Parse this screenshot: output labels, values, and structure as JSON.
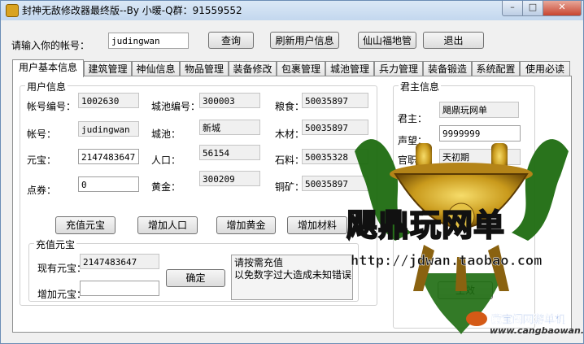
{
  "window": {
    "title": "封神无敌修改器最终版--By 小暖-Q群：91559552",
    "min_glyph": "–",
    "max_glyph": "□",
    "close_glyph": "✕"
  },
  "account": {
    "label": "请输入你的帐号：",
    "value": "judingwan"
  },
  "top_buttons": {
    "query": "查询",
    "refresh": "刷新用户信息",
    "xianshan": "仙山福地管",
    "exit": "退出"
  },
  "tabs": [
    "用户基本信息",
    "建筑管理",
    "神仙信息",
    "物品管理",
    "装备修改",
    "包裹管理",
    "城池管理",
    "兵力管理",
    "装备锻造",
    "系统配置",
    "使用必读"
  ],
  "user_info": {
    "group_title": "用户信息",
    "account_no_label": "帐号编号：",
    "account_no": "1002630",
    "account_label": "帐号：",
    "account": "judingwan",
    "yuanbao_label": "元宝：",
    "yuanbao": "2147483647",
    "dianquan_label": "点券：",
    "dianquan": "0",
    "city_no_label": "城池编号：",
    "city_no": "300003",
    "city_label": "城池：",
    "city": "新城",
    "population_label": "人口：",
    "population": "56154",
    "gold_label": "黄金：",
    "gold": "300209",
    "food_label": "粮食：",
    "food": "50035897",
    "wood_label": "木材：",
    "wood": "50035897",
    "stone_label": "石料：",
    "stone": "50035328",
    "copper_label": "铜矿：",
    "copper": "50035897"
  },
  "action_buttons": {
    "recharge_yuanbao": "充值元宝",
    "add_population": "增加人口",
    "add_gold": "增加黄金",
    "add_material": "增加材料"
  },
  "recharge": {
    "group_title": "充值元宝",
    "current_label": "现有元宝：",
    "current": "2147483647",
    "add_label": "增加元宝：",
    "add_value": "",
    "confirm": "确定",
    "note": "请按需充值\n以免数字过大造成未知错误"
  },
  "monarch": {
    "group_title": "君主信息",
    "lord_label": "君主：",
    "lord": "飓鼎玩网单",
    "prestige_label": "声望：",
    "prestige": "9999999",
    "rank_label": "官职：",
    "rank": "天初期",
    "hidden_button": "生效"
  },
  "watermark": {
    "brand": "飓鼎玩网单",
    "url": "http://jdwan.taobao.com",
    "site_name": "藏宝阁网游单机",
    "site_url": "www.cangbaowan.net"
  },
  "colors": {
    "gold": "#d9a321",
    "green_glow": "#2a7d12",
    "titlebar": "#c3d7ee",
    "close": "#c8452f"
  }
}
